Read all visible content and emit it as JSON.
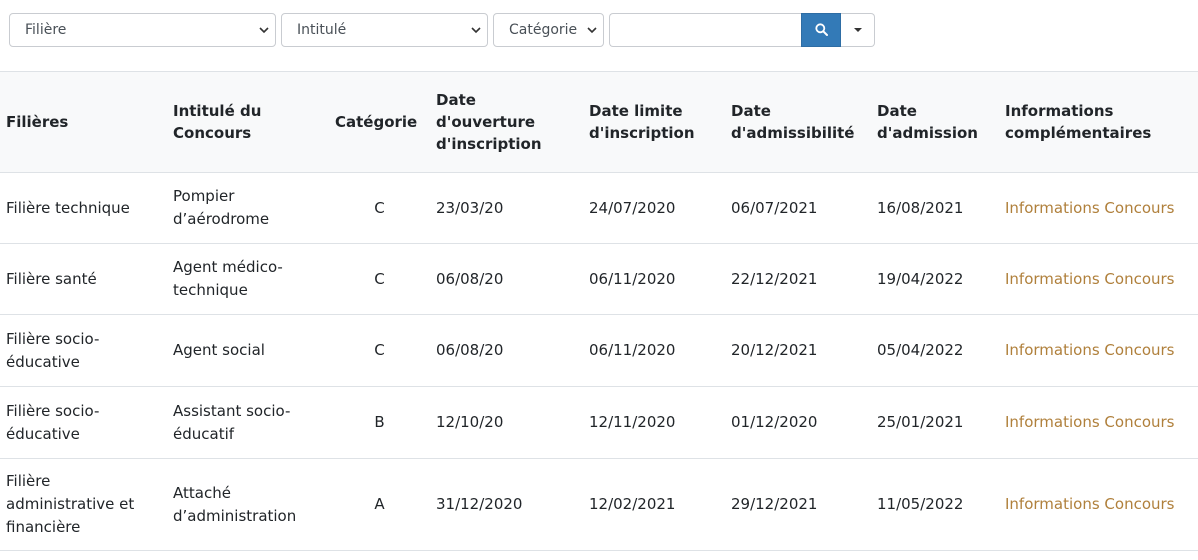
{
  "filters": {
    "filiere": {
      "selected": "Filière"
    },
    "intitule": {
      "selected": "Intitulé"
    },
    "categorie": {
      "selected": "Catégorie"
    },
    "search": {
      "value": "",
      "placeholder": ""
    }
  },
  "icons": {
    "search": "search-icon",
    "dropdown": "caret-down-icon",
    "select_chevron": "chevron-down-icon"
  },
  "colors": {
    "search_button": "#337ab7",
    "link": "#b0803c",
    "header_bg": "#f8f9fa"
  },
  "table": {
    "headers": [
      "Filières",
      "Intitulé du Concours",
      "Catégorie",
      "Date d'ouverture d'inscription",
      "Date limite d'inscription",
      "Date d'admissibilité",
      "Date d'admission",
      "Informations complémentaires"
    ],
    "rows": [
      {
        "filiere": "Filière technique",
        "intitule": "Pompier d’aérodrome",
        "categorie": "C",
        "ouverture": "23/03/20",
        "limite": "24/07/2020",
        "admissibilite": "06/07/2021",
        "admission": "16/08/2021",
        "info": "Informations Concours"
      },
      {
        "filiere": "Filière santé",
        "intitule": "Agent médico-technique",
        "categorie": "C",
        "ouverture": "06/08/20",
        "limite": "06/11/2020",
        "admissibilite": "22/12/2021",
        "admission": "19/04/2022",
        "info": "Informations Concours"
      },
      {
        "filiere": "Filière socio-éducative",
        "intitule": "Agent social",
        "categorie": "C",
        "ouverture": "06/08/20",
        "limite": "06/11/2020",
        "admissibilite": "20/12/2021",
        "admission": "05/04/2022",
        "info": "Informations Concours"
      },
      {
        "filiere": "Filière socio-éducative",
        "intitule": "Assistant socio-éducatif",
        "categorie": "B",
        "ouverture": "12/10/20",
        "limite": "12/11/2020",
        "admissibilite": "01/12/2020",
        "admission": "25/01/2021",
        "info": "Informations Concours"
      },
      {
        "filiere": "Filière administrative et financière",
        "intitule": "Attaché d’administration",
        "categorie": "A",
        "ouverture": "31/12/2020",
        "limite": "12/02/2021",
        "admissibilite": "29/12/2021",
        "admission": "11/05/2022",
        "info": "Informations Concours"
      }
    ]
  }
}
